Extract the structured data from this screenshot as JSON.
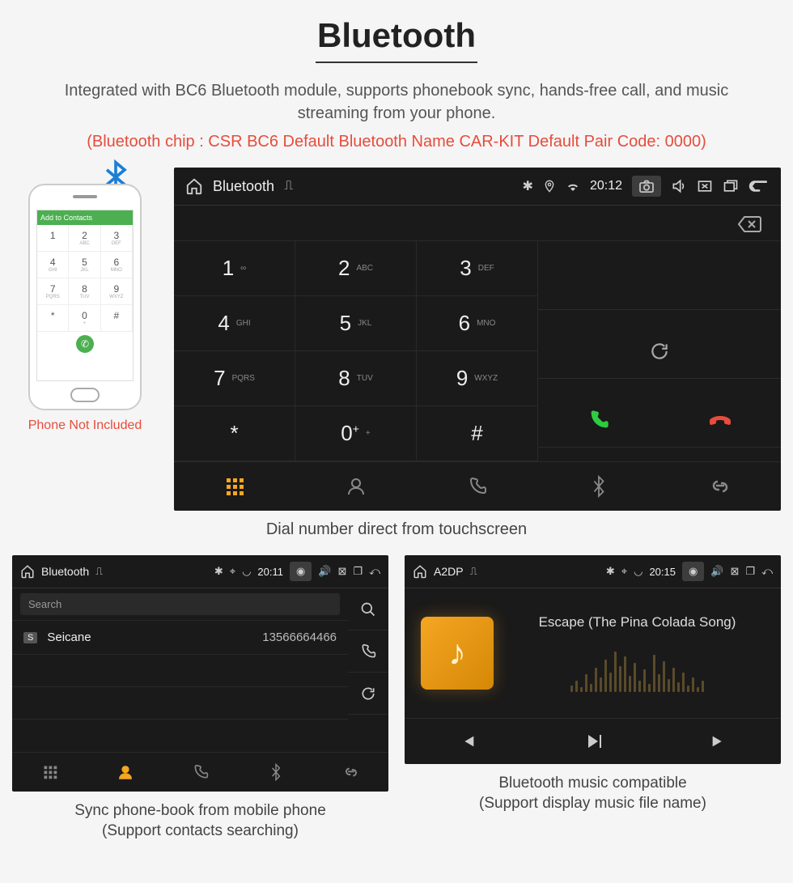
{
  "header": {
    "title": "Bluetooth",
    "intro": "Integrated with BC6 Bluetooth module, supports phonebook sync, hands-free call, and music streaming from your phone.",
    "spec_line": "(Bluetooth chip : CSR BC6    Default Bluetooth Name CAR-KIT    Default Pair Code: 0000)"
  },
  "phone_mock": {
    "header": "Add to Contacts",
    "keys": [
      {
        "n": "1",
        "l": ""
      },
      {
        "n": "2",
        "l": "ABC"
      },
      {
        "n": "3",
        "l": "DEF"
      },
      {
        "n": "4",
        "l": "GHI"
      },
      {
        "n": "5",
        "l": "JKL"
      },
      {
        "n": "6",
        "l": "MNO"
      },
      {
        "n": "7",
        "l": "PQRS"
      },
      {
        "n": "8",
        "l": "TUV"
      },
      {
        "n": "9",
        "l": "WXYZ"
      },
      {
        "n": "*",
        "l": ""
      },
      {
        "n": "0",
        "l": "+"
      },
      {
        "n": "#",
        "l": ""
      }
    ],
    "caption": "Phone Not Included"
  },
  "main_hu": {
    "status": {
      "title": "Bluetooth",
      "time": "20:12"
    },
    "keypad": [
      {
        "n": "1",
        "l": "∞"
      },
      {
        "n": "2",
        "l": "ABC"
      },
      {
        "n": "3",
        "l": "DEF"
      },
      {
        "n": "4",
        "l": "GHI"
      },
      {
        "n": "5",
        "l": "JKL"
      },
      {
        "n": "6",
        "l": "MNO"
      },
      {
        "n": "7",
        "l": "PQRS"
      },
      {
        "n": "8",
        "l": "TUV"
      },
      {
        "n": "9",
        "l": "WXYZ"
      },
      {
        "n": "*",
        "l": ""
      },
      {
        "n": "0",
        "l": "+",
        "sup": "+"
      },
      {
        "n": "#",
        "l": ""
      }
    ],
    "caption": "Dial number direct from touchscreen"
  },
  "contacts_hu": {
    "status": {
      "title": "Bluetooth",
      "time": "20:11"
    },
    "search_placeholder": "Search",
    "contacts": [
      {
        "badge": "S",
        "name": "Seicane",
        "number": "13566664466"
      }
    ],
    "caption_line1": "Sync phone-book from mobile phone",
    "caption_line2": "(Support contacts searching)"
  },
  "music_hu": {
    "status": {
      "title": "A2DP",
      "time": "20:15"
    },
    "song": "Escape (The Pina Colada Song)",
    "caption_line1": "Bluetooth music compatible",
    "caption_line2": "(Support display music file name)"
  }
}
